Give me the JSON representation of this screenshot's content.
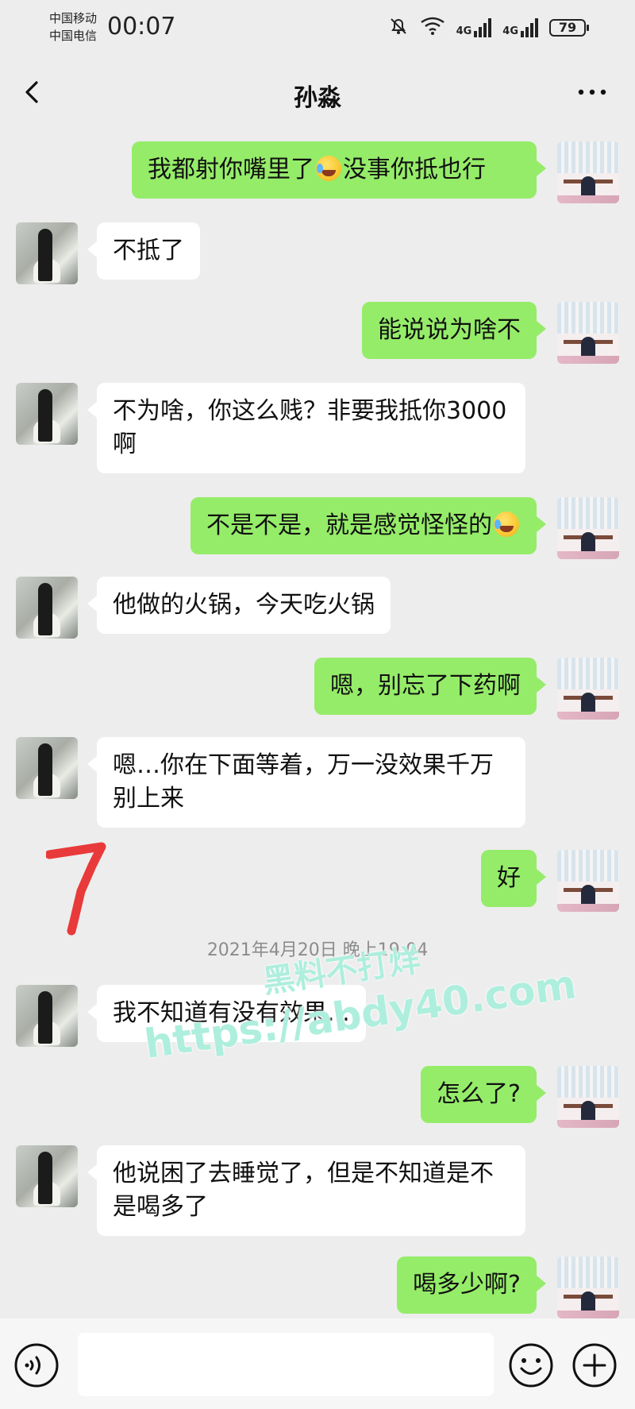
{
  "status_bar": {
    "carrier_1": "中国移动",
    "carrier_2": "中国电信",
    "time": "00:07",
    "network_1": "4G",
    "network_2": "4G",
    "battery": "79"
  },
  "header": {
    "title": "孙淼"
  },
  "messages": [
    {
      "side": "out",
      "text_before": "我都射你嘴里了",
      "text_after": "没事你抵也行",
      "emoji": "tears-of-joy-emoji-icon"
    },
    {
      "side": "in",
      "text": "不抵了"
    },
    {
      "side": "out",
      "text": "能说说为啥不"
    },
    {
      "side": "in",
      "text": "不为啥，你这么贱？非要我抵你3000啊"
    },
    {
      "side": "out",
      "text": "不是不是，就是感觉怪怪的",
      "emoji": "tears-of-joy-emoji-icon"
    },
    {
      "side": "in",
      "text": "他做的火锅，今天吃火锅"
    },
    {
      "side": "out",
      "text": "嗯，别忘了下药啊"
    },
    {
      "side": "in",
      "text": "嗯…你在下面等着，万一没效果千万别上来"
    },
    {
      "side": "out",
      "text": "好"
    },
    {
      "side": "in",
      "text": "我不知道有没有效果..."
    },
    {
      "side": "out",
      "text": "怎么了?"
    },
    {
      "side": "in",
      "text": "他说困了去睡觉了，但是不知道是不是喝多了"
    },
    {
      "side": "out",
      "text": "喝多少啊?"
    }
  ],
  "timestamp": "2021年4月20日 晚上19:04",
  "annotation_mark": "7",
  "watermark": {
    "line1": "黑料不打烊",
    "line2": "https://abdy40.com"
  },
  "input_bar": {
    "placeholder": ""
  },
  "colors": {
    "background": "#ededed",
    "outgoing_bubble": "#95ec69",
    "incoming_bubble": "#ffffff"
  }
}
